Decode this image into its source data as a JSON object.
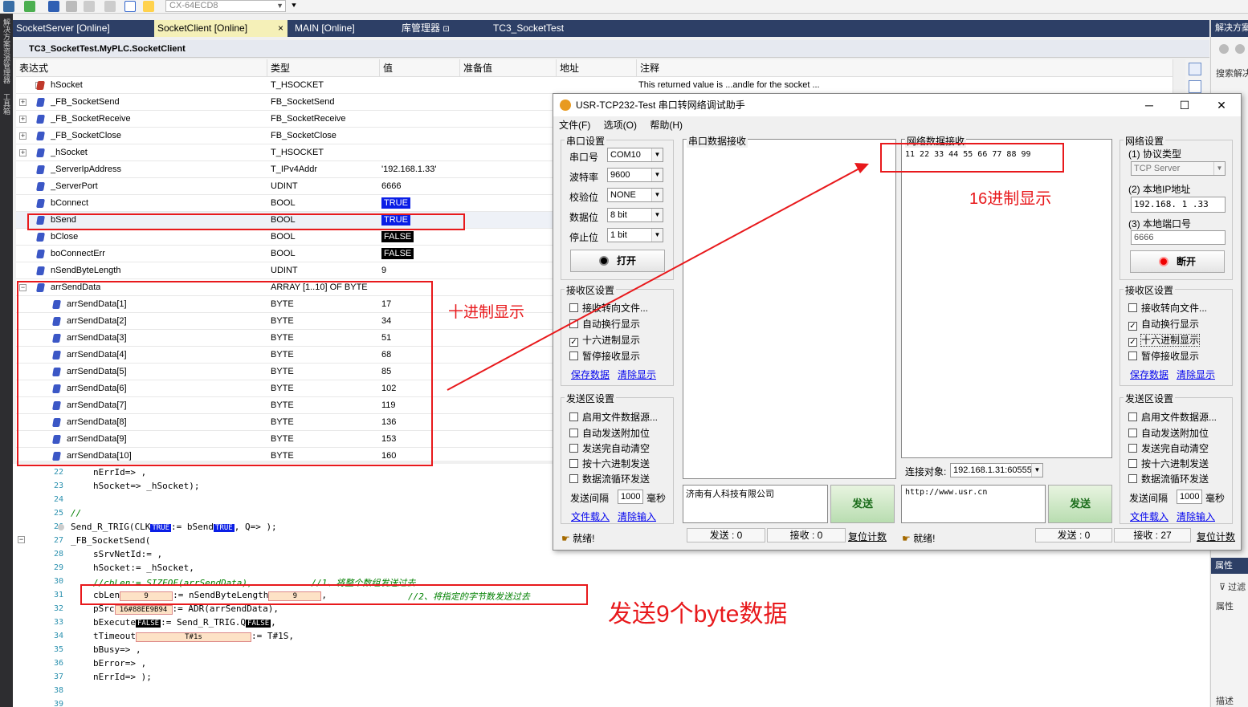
{
  "toolbar": {
    "target": "CX-64ECD8"
  },
  "left_strip": {
    "labels": [
      "解决方案资源管理器",
      "工具箱"
    ]
  },
  "tabs": [
    {
      "label": "SocketServer [Online]"
    },
    {
      "label": "SocketClient [Online]",
      "close": "×"
    },
    {
      "label": "MAIN [Online]"
    },
    {
      "label": "库管理器"
    },
    {
      "label": "TC3_SocketTest"
    }
  ],
  "right_panel": {
    "title": "解决方案",
    "search": "搜索解决",
    "props_title": "属性",
    "filter": "过滤",
    "props_label": "属性",
    "desc": "描述"
  },
  "watch": {
    "title": "TC3_SocketTest.MyPLC.SocketClient",
    "columns": [
      "表达式",
      "类型",
      "值",
      "准备值",
      "地址",
      "注释"
    ],
    "rows": [
      {
        "name": "hSocket",
        "type": "T_HSOCKET",
        "value": "",
        "comment": "This returned value is ...andle for the socket ..."
      },
      {
        "name": "_FB_SocketSend",
        "type": "FB_SocketSend",
        "value": "",
        "comment": ""
      },
      {
        "name": "_FB_SocketReceive",
        "type": "FB_SocketReceive",
        "value": "",
        "comment": ""
      },
      {
        "name": "_FB_SocketClose",
        "type": "FB_SocketClose",
        "value": "",
        "comment": ""
      },
      {
        "name": "_hSocket",
        "type": "T_HSOCKET",
        "value": "",
        "comment": ""
      },
      {
        "name": "_ServerIpAddress",
        "type": "T_IPv4Addr",
        "value": "'192.168.1.33'",
        "comment": ""
      },
      {
        "name": "_ServerPort",
        "type": "UDINT",
        "value": "6666",
        "comment": ""
      },
      {
        "name": "bConnect",
        "type": "BOOL",
        "value": "TRUE",
        "comment": ""
      },
      {
        "name": "bSend",
        "type": "BOOL",
        "value": "TRUE",
        "comment": ""
      },
      {
        "name": "bClose",
        "type": "BOOL",
        "value": "FALSE",
        "comment": ""
      },
      {
        "name": "boConnectErr",
        "type": "BOOL",
        "value": "FALSE",
        "comment": ""
      },
      {
        "name": "nSendByteLength",
        "type": "UDINT",
        "value": "9",
        "comment": ""
      },
      {
        "name": "arrSendData",
        "type": "ARRAY [1..10] OF BYTE",
        "value": "",
        "comment": ""
      },
      {
        "name": "arrSendData[1]",
        "type": "BYTE",
        "value": "17",
        "comment": ""
      },
      {
        "name": "arrSendData[2]",
        "type": "BYTE",
        "value": "34",
        "comment": ""
      },
      {
        "name": "arrSendData[3]",
        "type": "BYTE",
        "value": "51",
        "comment": ""
      },
      {
        "name": "arrSendData[4]",
        "type": "BYTE",
        "value": "68",
        "comment": ""
      },
      {
        "name": "arrSendData[5]",
        "type": "BYTE",
        "value": "85",
        "comment": ""
      },
      {
        "name": "arrSendData[6]",
        "type": "BYTE",
        "value": "102",
        "comment": ""
      },
      {
        "name": "arrSendData[7]",
        "type": "BYTE",
        "value": "119",
        "comment": ""
      },
      {
        "name": "arrSendData[8]",
        "type": "BYTE",
        "value": "136",
        "comment": ""
      },
      {
        "name": "arrSendData[9]",
        "type": "BYTE",
        "value": "153",
        "comment": ""
      },
      {
        "name": "arrSendData[10]",
        "type": "BYTE",
        "value": "160",
        "comment": ""
      }
    ]
  },
  "code": {
    "line_numbers": [
      "22",
      "23",
      "24",
      "25",
      "26",
      "27",
      "28",
      "29",
      "30",
      "31",
      "32",
      "33",
      "34",
      "35",
      "36",
      "37",
      "38",
      "39"
    ],
    "l22": "nErrId=> ,",
    "l23": "hSocket=> _hSocket);",
    "l25": "//",
    "l26_a": "Send_R_TRIG(CLK",
    "l26_b": ":= bSend",
    "l26_c": ", Q=> );",
    "l27": "_FB_SocketSend(",
    "l28": "sSrvNetId:= ,",
    "l29": "hSocket:= _hSocket,",
    "l30": "//cbLen:= SIZEOF(arrSendData),           //1、将整个数组发送过去",
    "l31_a": "cbLen",
    "l31_b": ":= nSendByteLength",
    "l31_c": ",",
    "l31_comment": "//2、将指定的字节数发送过去",
    "l32_a": "pSrc",
    "l32_b": ":= ADR(arrSendData),",
    "l33_a": "bExecute",
    "l33_b": ":= Send_R_TRIG.Q",
    "l33_c": ",",
    "l34_a": "tTimeout",
    "l34_b": ":= T#1S,",
    "l35": "bBusy=> ,",
    "l36": "bError=> ,",
    "l37": "nErrId=> );",
    "inline_true": "TRUE",
    "inline_false": "FALSE",
    "inline_cblen": "9",
    "inline_nsend": "9",
    "inline_psrc": "16#88EE9B94",
    "inline_tt": "T#1s"
  },
  "annotations": {
    "decimal": "十进制显示",
    "hex": "16进制显示",
    "send9": "发送9个byte数据"
  },
  "dialog": {
    "title": "USR-TCP232-Test 串口转网络调试助手",
    "win_min": "─",
    "win_max": "☐",
    "win_close": "✕",
    "menu": [
      "文件(F)",
      "选项(O)",
      "帮助(H)"
    ],
    "serial": {
      "title": "串口设置",
      "port_label": "串口号",
      "port": "COM10",
      "baud_label": "波特率",
      "baud": "9600",
      "parity_label": "校验位",
      "parity": "NONE",
      "data_label": "数据位",
      "data": "8 bit",
      "stop_label": "停止位",
      "stop": "1 bit",
      "open_btn": "打开"
    },
    "serial_recv_pane": "串口数据接收",
    "net_recv_pane": "网络数据接收",
    "net_recv_content": "11 22 33 44 55 66 77 88 99",
    "left_recv": {
      "title": "接收区设置",
      "opt1": "接收转向文件...",
      "opt2": "自动换行显示",
      "opt3": "十六进制显示",
      "opt4": "暂停接收显示",
      "save": "保存数据",
      "clear": "清除显示"
    },
    "left_send": {
      "title": "发送区设置",
      "opt1": "启用文件数据源...",
      "opt2": "自动发送附加位",
      "opt3": "发送完自动清空",
      "opt4": "按十六进制发送",
      "opt5": "数据流循环发送",
      "interval_label": "发送间隔",
      "interval": "1000",
      "unit": "毫秒",
      "load": "文件载入",
      "clear": "清除输入"
    },
    "serial_send_text": "济南有人科技有限公司",
    "send_btn": "发送",
    "net": {
      "title": "网络设置",
      "proto_label": "(1) 协议类型",
      "proto": "TCP Server",
      "ip_label": "(2) 本地IP地址",
      "ip": "192.168. 1 .33",
      "port_label": "(3) 本地端口号",
      "port": "6666",
      "disconnect_btn": "断开"
    },
    "right_recv": {
      "title": "接收区设置",
      "opt1": "接收转向文件...",
      "opt2": "自动换行显示",
      "opt3": "十六进制显示",
      "opt4": "暂停接收显示",
      "save": "保存数据",
      "clear": "清除显示"
    },
    "right_send": {
      "title": "发送区设置",
      "opt1": "启用文件数据源...",
      "opt2": "自动发送附加位",
      "opt3": "发送完自动清空",
      "opt4": "按十六进制发送",
      "opt5": "数据流循环发送",
      "interval_label": "发送间隔",
      "interval": "1000",
      "unit": "毫秒",
      "load": "文件载入",
      "clear": "清除输入"
    },
    "connect_label": "连接对象:",
    "connect_target": "192.168.1.31:60555",
    "net_send_text": "http://www.usr.cn",
    "status_left": "就绪!",
    "status_right": "就绪!",
    "left_sent": "发送 : 0",
    "left_recv_count": "接收 : 0",
    "reset": "复位计数",
    "right_sent": "发送 : 0",
    "right_recv_count": "接收 : 27",
    "reset2": "复位计数"
  },
  "colors": {
    "accent_red": "#e8191c",
    "true_blue": "#0a1ee6",
    "tab_bar": "#2d3f66"
  }
}
